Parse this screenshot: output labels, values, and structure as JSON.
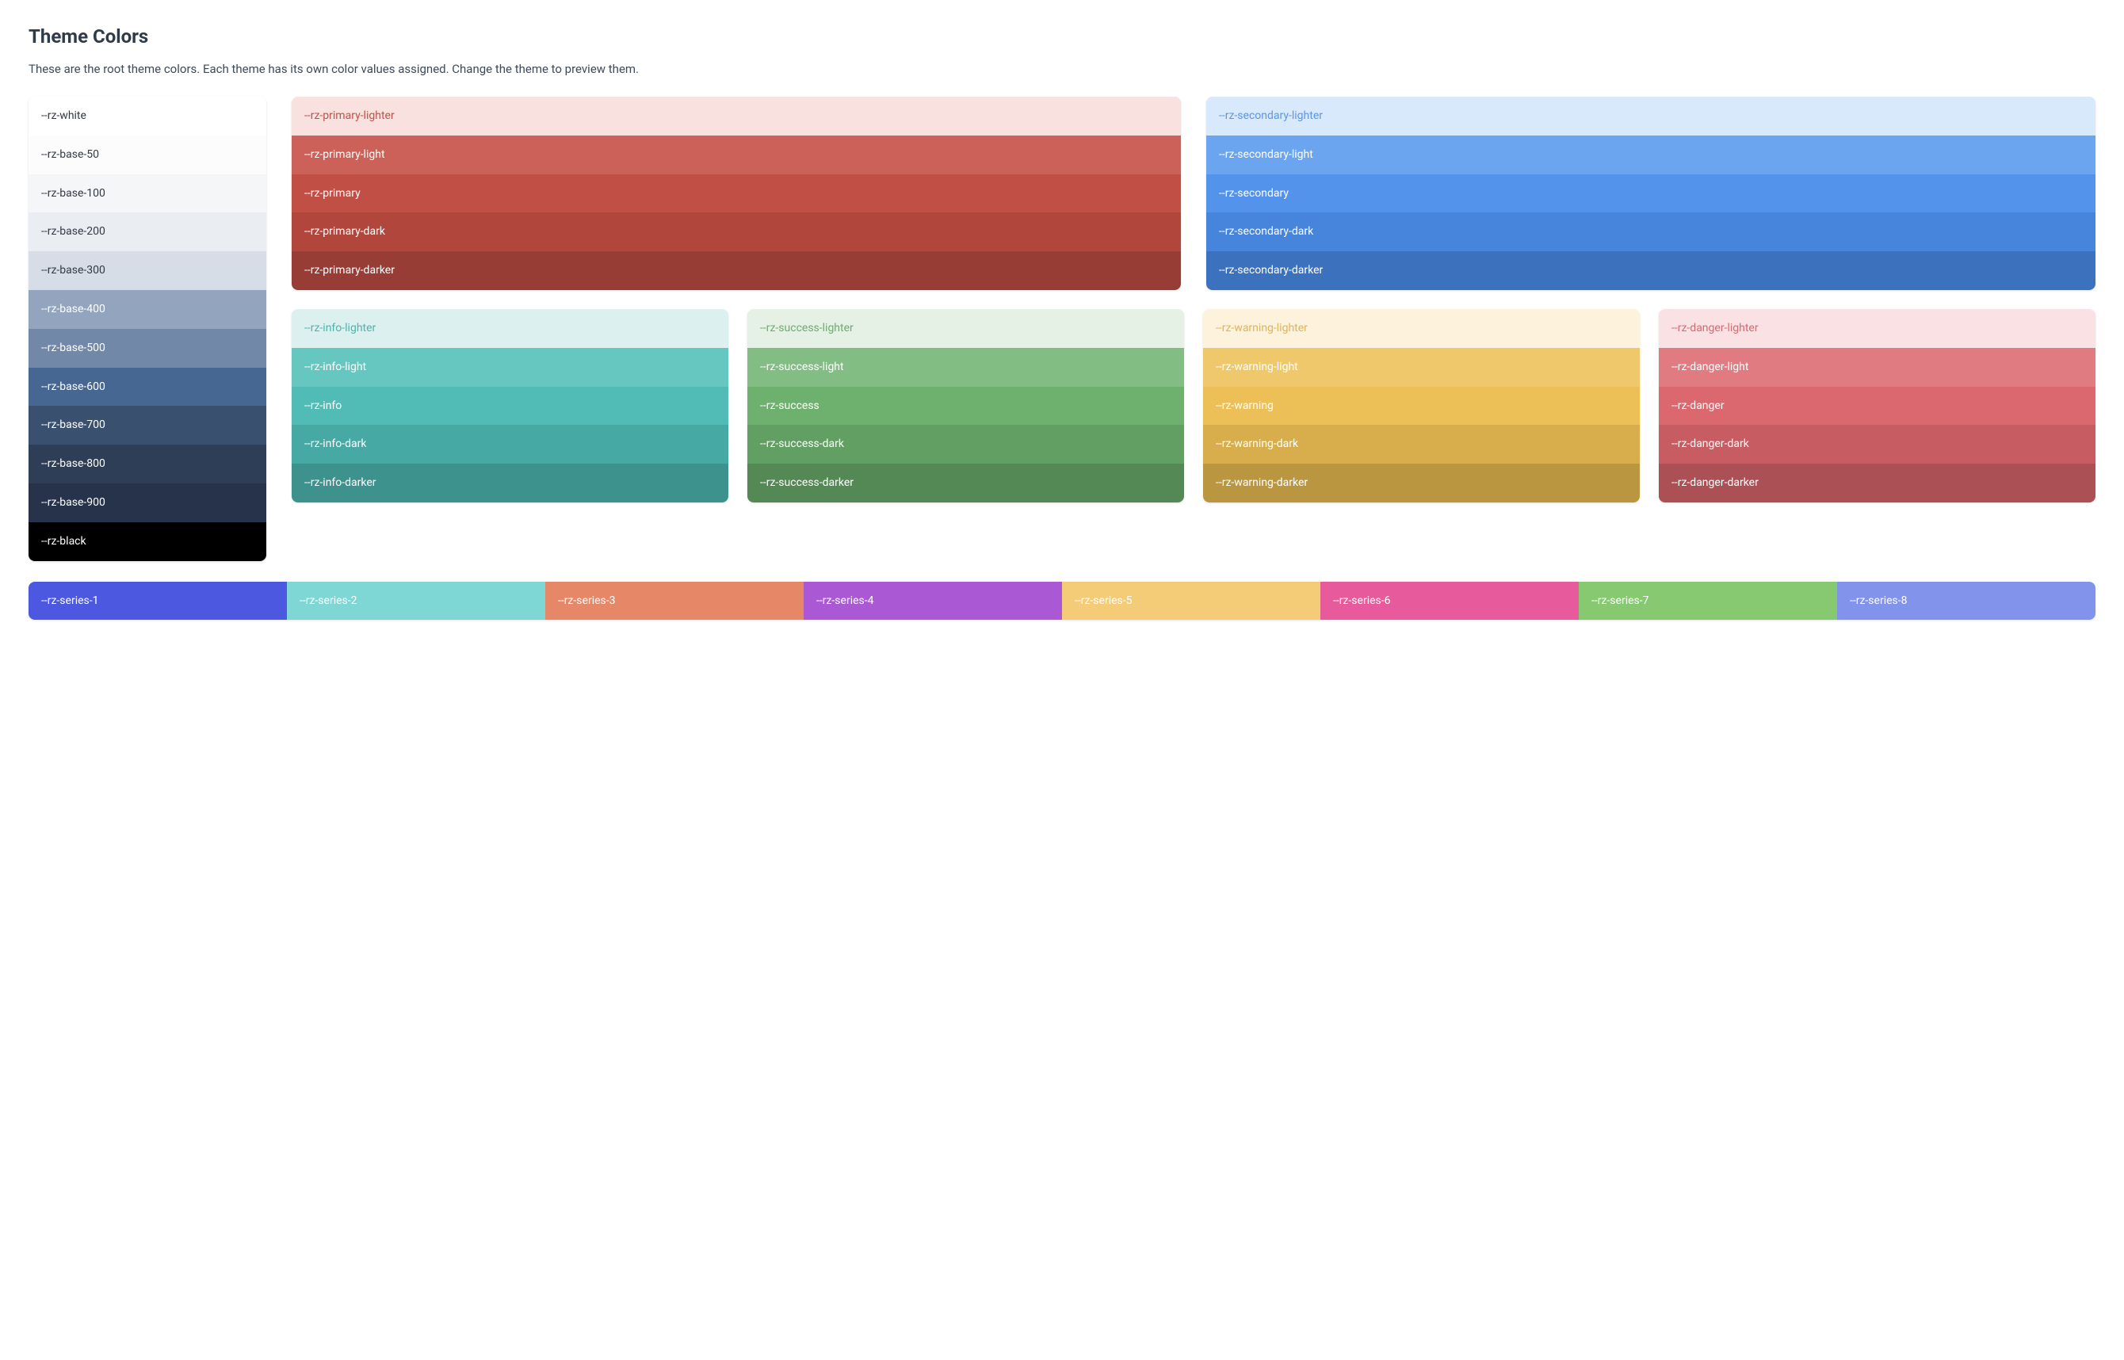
{
  "title": "Theme Colors",
  "description": "These are the root theme colors. Each theme has its own color values assigned. Change the theme to preview them.",
  "base": [
    {
      "label": "--rz-white",
      "bg": "#ffffff",
      "fg": "#323a46"
    },
    {
      "label": "--rz-base-50",
      "bg": "#fcfcfd",
      "fg": "#323a46"
    },
    {
      "label": "--rz-base-100",
      "bg": "#f5f6f8",
      "fg": "#323a46"
    },
    {
      "label": "--rz-base-200",
      "bg": "#eaedf1",
      "fg": "#323a46"
    },
    {
      "label": "--rz-base-300",
      "bg": "#d7dde6",
      "fg": "#323a46"
    },
    {
      "label": "--rz-base-400",
      "bg": "#92a4be",
      "fg": "#ffffff"
    },
    {
      "label": "--rz-base-500",
      "bg": "#7288a8",
      "fg": "#ffffff"
    },
    {
      "label": "--rz-base-600",
      "bg": "#456791",
      "fg": "#ffffff"
    },
    {
      "label": "--rz-base-700",
      "bg": "#3a506f",
      "fg": "#ffffff"
    },
    {
      "label": "--rz-base-800",
      "bg": "#2e3e57",
      "fg": "#ffffff"
    },
    {
      "label": "--rz-base-900",
      "bg": "#26334a",
      "fg": "#ffffff"
    },
    {
      "label": "--rz-black",
      "bg": "#000000",
      "fg": "#ffffff"
    }
  ],
  "primary": [
    {
      "label": "--rz-primary-lighter",
      "bg": "#f8e1de",
      "fg": "#c25148"
    },
    {
      "label": "--rz-primary-light",
      "bg": "#cb6158",
      "fg": "#ffffff"
    },
    {
      "label": "--rz-primary",
      "bg": "#c14f45",
      "fg": "#ffffff"
    },
    {
      "label": "--rz-primary-dark",
      "bg": "#b1463d",
      "fg": "#ffffff"
    },
    {
      "label": "--rz-primary-darker",
      "bg": "#973d35",
      "fg": "#ffffff"
    }
  ],
  "secondary": [
    {
      "label": "--rz-secondary-lighter",
      "bg": "#d9e9fc",
      "fg": "#5a96e6"
    },
    {
      "label": "--rz-secondary-light",
      "bg": "#6ba5ef",
      "fg": "#ffffff"
    },
    {
      "label": "--rz-secondary",
      "bg": "#5493eb",
      "fg": "#ffffff"
    },
    {
      "label": "--rz-secondary-dark",
      "bg": "#4784db",
      "fg": "#ffffff"
    },
    {
      "label": "--rz-secondary-darker",
      "bg": "#3c72bd",
      "fg": "#ffffff"
    }
  ],
  "info": [
    {
      "label": "--rz-info-lighter",
      "bg": "#dbf0ef",
      "fg": "#4fb3ad"
    },
    {
      "label": "--rz-info-light",
      "bg": "#66c6c0",
      "fg": "#ffffff"
    },
    {
      "label": "--rz-info",
      "bg": "#50bcb5",
      "fg": "#ffffff"
    },
    {
      "label": "--rz-info-dark",
      "bg": "#46a9a3",
      "fg": "#ffffff"
    },
    {
      "label": "--rz-info-darker",
      "bg": "#3d928d",
      "fg": "#ffffff"
    }
  ],
  "success": [
    {
      "label": "--rz-success-lighter",
      "bg": "#e4f1e4",
      "fg": "#6fab70"
    },
    {
      "label": "--rz-success-light",
      "bg": "#82bd83",
      "fg": "#ffffff"
    },
    {
      "label": "--rz-success",
      "bg": "#6eb16f",
      "fg": "#ffffff"
    },
    {
      "label": "--rz-success-dark",
      "bg": "#619f62",
      "fg": "#ffffff"
    },
    {
      "label": "--rz-success-darker",
      "bg": "#548955",
      "fg": "#ffffff"
    }
  ],
  "warning": [
    {
      "label": "--rz-warning-lighter",
      "bg": "#fdf3dc",
      "fg": "#e1b453"
    },
    {
      "label": "--rz-warning-light",
      "bg": "#efc86b",
      "fg": "#ffffff"
    },
    {
      "label": "--rz-warning",
      "bg": "#ecc057",
      "fg": "#ffffff"
    },
    {
      "label": "--rz-warning-dark",
      "bg": "#d8ae4c",
      "fg": "#ffffff"
    },
    {
      "label": "--rz-warning-darker",
      "bg": "#ba9641",
      "fg": "#ffffff"
    }
  ],
  "danger": [
    {
      "label": "--rz-danger-lighter",
      "bg": "#fae1e3",
      "fg": "#d76a70"
    },
    {
      "label": "--rz-danger-light",
      "bg": "#e07c81",
      "fg": "#ffffff"
    },
    {
      "label": "--rz-danger",
      "bg": "#da686e",
      "fg": "#ffffff"
    },
    {
      "label": "--rz-danger-dark",
      "bg": "#c75c62",
      "fg": "#ffffff"
    },
    {
      "label": "--rz-danger-darker",
      "bg": "#ab5055",
      "fg": "#ffffff"
    }
  ],
  "series": [
    {
      "label": "--rz-series-1",
      "bg": "#4c58df",
      "fg": "#ffffff"
    },
    {
      "label": "--rz-series-2",
      "bg": "#7ed7d4",
      "fg": "#ffffff"
    },
    {
      "label": "--rz-series-3",
      "bg": "#e68867",
      "fg": "#ffffff"
    },
    {
      "label": "--rz-series-4",
      "bg": "#aa58d3",
      "fg": "#ffffff"
    },
    {
      "label": "--rz-series-5",
      "bg": "#f4cb77",
      "fg": "#ffffff"
    },
    {
      "label": "--rz-series-6",
      "bg": "#e75a9b",
      "fg": "#ffffff"
    },
    {
      "label": "--rz-series-7",
      "bg": "#86c971",
      "fg": "#ffffff"
    },
    {
      "label": "--rz-series-8",
      "bg": "#8193ea",
      "fg": "#ffffff"
    }
  ]
}
